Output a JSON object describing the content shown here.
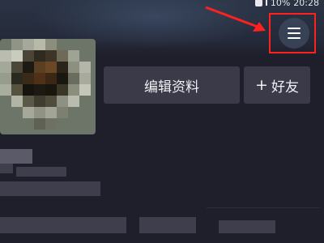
{
  "status_bar": {
    "battery_text": "10%",
    "time": "20:28"
  },
  "profile": {
    "edit_profile_label": "编辑资料",
    "add_friend_label": "好友"
  },
  "icons": {
    "menu": "hamburger-menu-icon",
    "add": "plus-icon"
  },
  "colors": {
    "background": "#1f1e2b",
    "button_bg": "#3a3a48",
    "highlight": "#ff2020"
  }
}
